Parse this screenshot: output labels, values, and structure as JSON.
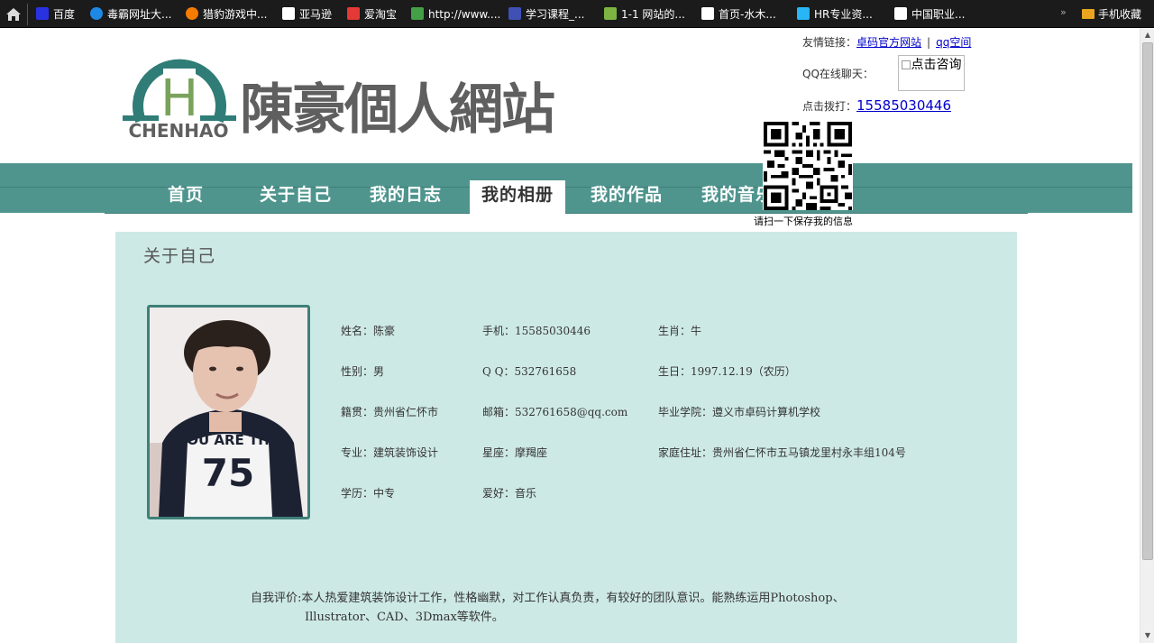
{
  "bookmarks": [
    {
      "label": "百度",
      "icon": "baidu-icon",
      "color": "#2932e1"
    },
    {
      "label": "毒霸网址大...",
      "icon": "duba-icon",
      "color": "#1e88e5"
    },
    {
      "label": "猎豹游戏中...",
      "icon": "liebao-icon",
      "color": "#f57c00"
    },
    {
      "label": "亚马逊",
      "icon": "amazon-icon",
      "color": "#ffffff"
    },
    {
      "label": "爱淘宝",
      "icon": "aitaobao-icon",
      "color": "#e53935"
    },
    {
      "label": "http://www....",
      "icon": "page-green-icon",
      "color": "#43a047"
    },
    {
      "label": "学习课程_...",
      "icon": "paw-icon",
      "color": "#3f51b5"
    },
    {
      "label": "1-1 网站的...",
      "icon": "shield-icon",
      "color": "#7cb342"
    },
    {
      "label": "首页-水木...",
      "icon": "doc-icon",
      "color": "#ffffff"
    },
    {
      "label": "HR专业资...",
      "icon": "bird-icon",
      "color": "#29b6f6"
    },
    {
      "label": "中国职业...",
      "icon": "doc-icon",
      "color": "#ffffff"
    }
  ],
  "bookmarks_more": "»",
  "bookmarks_folder": "手机收藏",
  "header": {
    "logo_letter": "H",
    "logo_text": "CHENHAO",
    "site_title": "陳豪個人網站",
    "friend_links_label": "友情链接：",
    "friend_links": [
      "卓码官方网站",
      "qq空间"
    ],
    "friend_sep": "|",
    "qq_chat_label": "QQ在线聊天：",
    "qq_consult_alt": "点击咨询",
    "phone_label": "点击拨打：",
    "phone": "15585030446",
    "qr_caption": "请扫一下保存我的信息"
  },
  "nav": {
    "items": [
      "首页",
      "关于自己",
      "我的日志",
      "我的相册",
      "我的作品",
      "我的音乐"
    ],
    "active": "我的相册"
  },
  "about": {
    "title": "关于自己",
    "fields": {
      "name": "姓名：陈豪",
      "phone": "手机：15585030446",
      "zodiac": "生肖：牛",
      "gender": "性别：男",
      "qq": "Q Q：532761658",
      "birthday": "生日：1997.12.19（农历）",
      "native": "籍贯：贵州省仁怀市",
      "email": "邮箱：532761658@qq.com",
      "school": "毕业学院：遵义市卓码计算机学校",
      "major": "专业：建筑装饰设计",
      "constellation": "星座：摩羯座",
      "address": "家庭住址：贵州省仁怀市五马镇龙里村永丰组104号",
      "education": "学历：中专",
      "hobby": "爱好：音乐"
    },
    "self_eval_1": "自我评价:本人热爱建筑装饰设计工作，性格幽默，对工作认真负责，有较好的团队意识。能熟练运用Photoshop、",
    "self_eval_2": "Illustrator、CAD、3Dmax等软件。",
    "photo_shirt_text": "YOU ARE THE",
    "photo_shirt_number": "75"
  },
  "colors": {
    "nav_band": "#4f958e",
    "content_bg": "#cde9e6",
    "logo_teal": "#2f7d76",
    "logo_green": "#79a35a"
  }
}
